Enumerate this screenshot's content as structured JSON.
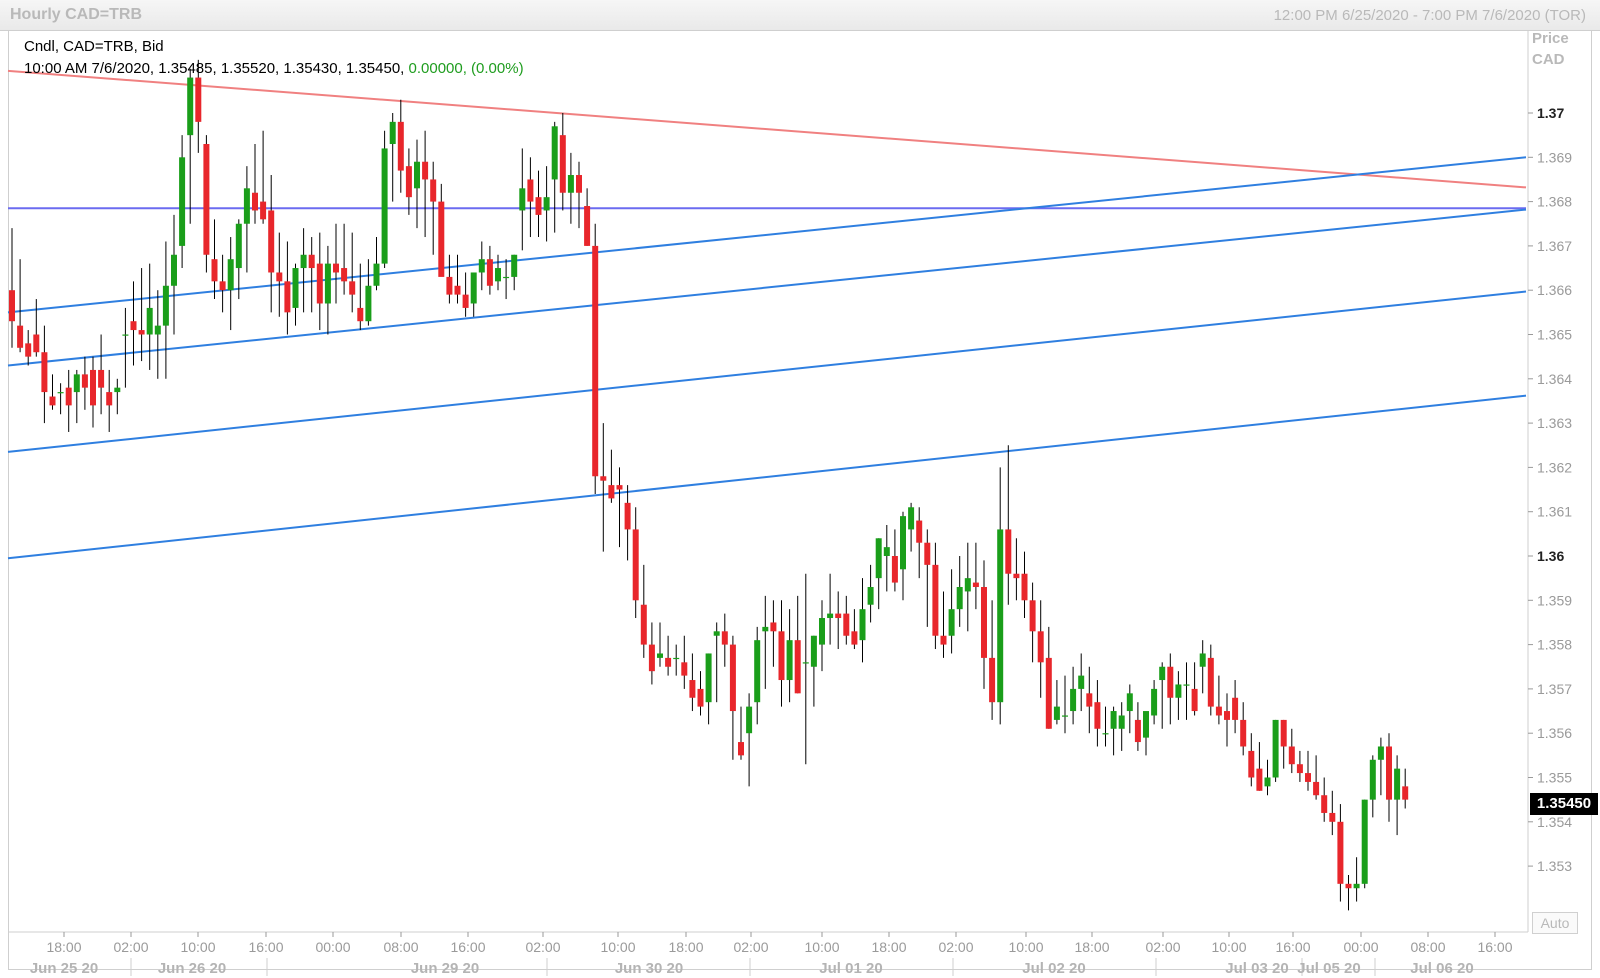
{
  "header": {
    "title": "Hourly CAD=TRB",
    "range": "12:00 PM 6/25/2020 - 7:00 PM 7/6/2020 (TOR)"
  },
  "legend": {
    "line1": "Cndl, CAD=TRB, Bid",
    "line2": "10:00 AM 7/6/2020, 1.35485, 1.35520, 1.35430, 1.35450,",
    "change": "0.00000, (0.00%)"
  },
  "axis": {
    "price_label_1": "Price",
    "price_label_2": "CAD",
    "auto": "Auto",
    "last_price": "1.35450"
  },
  "colors": {
    "up": "#1a9e1a",
    "down": "#e8262b",
    "wick": "#000000",
    "trend_red": "#f08080",
    "trend_blue": "#2f7fe0",
    "horizontal": "#6b6bf0"
  },
  "chart_data": {
    "type": "candlestick",
    "title": "Hourly CAD=TRB",
    "ylabel": "Price CAD",
    "ylim": [
      1.3521,
      1.3714
    ],
    "yticks": [
      "1.37",
      "1.369",
      "1.368",
      "1.367",
      "1.366",
      "1.365",
      "1.364",
      "1.363",
      "1.362",
      "1.361",
      "1.36",
      "1.359",
      "1.358",
      "1.357",
      "1.356",
      "1.355",
      "1.354",
      "1.353"
    ],
    "x_time_labels": [
      "18:00",
      "02:00",
      "10:00",
      "16:00",
      "00:00",
      "08:00",
      "16:00",
      "02:00",
      "10:00",
      "18:00",
      "02:00",
      "10:00",
      "18:00",
      "02:00",
      "10:00",
      "18:00",
      "02:00",
      "10:00",
      "16:00",
      "00:00",
      "08:00",
      "16:00"
    ],
    "x_date_labels": [
      "Jun 25 20",
      "Jun 26 20",
      "Jun 29 20",
      "Jun 30 20",
      "Jul 01 20",
      "Jul 02 20",
      "Jul 03 20",
      "Jul 05 20",
      "Jul 06 20"
    ],
    "candles": [
      [
        1.366,
        1.3674,
        1.3647,
        1.3653
      ],
      [
        1.3652,
        1.3667,
        1.3646,
        1.3647
      ],
      [
        1.3648,
        1.3651,
        1.3643,
        1.3645
      ],
      [
        1.365,
        1.3658,
        1.3645,
        1.3646
      ],
      [
        1.3646,
        1.3652,
        1.363,
        1.3637
      ],
      [
        1.3636,
        1.3641,
        1.3633,
        1.3634
      ],
      [
        1.3637,
        1.3639,
        1.3632,
        1.3637
      ],
      [
        1.3638,
        1.3642,
        1.3628,
        1.3634
      ],
      [
        1.3637,
        1.3642,
        1.363,
        1.3641
      ],
      [
        1.3641,
        1.3645,
        1.3633,
        1.3638
      ],
      [
        1.3642,
        1.3645,
        1.3629,
        1.3634
      ],
      [
        1.3642,
        1.365,
        1.3632,
        1.3638
      ],
      [
        1.3637,
        1.3642,
        1.3628,
        1.3634
      ],
      [
        1.3637,
        1.364,
        1.3632,
        1.3638
      ],
      [
        1.365,
        1.3656,
        1.3638,
        1.365
      ],
      [
        1.3653,
        1.3662,
        1.3643,
        1.3651
      ],
      [
        1.3651,
        1.3665,
        1.3644,
        1.365
      ],
      [
        1.365,
        1.3666,
        1.3642,
        1.3656
      ],
      [
        1.365,
        1.366,
        1.364,
        1.3652
      ],
      [
        1.3652,
        1.3671,
        1.364,
        1.3661
      ],
      [
        1.3661,
        1.3677,
        1.365,
        1.3668
      ],
      [
        1.367,
        1.3695,
        1.3665,
        1.369
      ],
      [
        1.3695,
        1.371,
        1.3675,
        1.3708
      ],
      [
        1.3708,
        1.3712,
        1.3691,
        1.3698
      ],
      [
        1.3693,
        1.3695,
        1.3664,
        1.3668
      ],
      [
        1.3667,
        1.3676,
        1.3658,
        1.3662
      ],
      [
        1.3662,
        1.3668,
        1.3655,
        1.366
      ],
      [
        1.366,
        1.3672,
        1.3651,
        1.3667
      ],
      [
        1.3665,
        1.3676,
        1.3658,
        1.3675
      ],
      [
        1.3675,
        1.3688,
        1.3664,
        1.3683
      ],
      [
        1.3682,
        1.3693,
        1.3675,
        1.3678
      ],
      [
        1.368,
        1.3696,
        1.3675,
        1.3676
      ],
      [
        1.3678,
        1.3686,
        1.3655,
        1.3664
      ],
      [
        1.3664,
        1.3673,
        1.3654,
        1.3662
      ],
      [
        1.3662,
        1.3671,
        1.365,
        1.3655
      ],
      [
        1.3656,
        1.3666,
        1.3652,
        1.3665
      ],
      [
        1.3665,
        1.3674,
        1.3655,
        1.3668
      ],
      [
        1.3668,
        1.3672,
        1.3655,
        1.3665
      ],
      [
        1.3666,
        1.3673,
        1.3651,
        1.3657
      ],
      [
        1.3657,
        1.367,
        1.365,
        1.3666
      ],
      [
        1.3666,
        1.3675,
        1.3657,
        1.3664
      ],
      [
        1.3665,
        1.3675,
        1.3659,
        1.3662
      ],
      [
        1.3662,
        1.3673,
        1.3655,
        1.3659
      ],
      [
        1.3656,
        1.3666,
        1.3651,
        1.3653
      ],
      [
        1.3653,
        1.3667,
        1.3652,
        1.3661
      ],
      [
        1.3661,
        1.3672,
        1.366,
        1.3666
      ],
      [
        1.3666,
        1.3696,
        1.3665,
        1.3692
      ],
      [
        1.3693,
        1.37,
        1.368,
        1.3698
      ],
      [
        1.3698,
        1.3703,
        1.3682,
        1.3687
      ],
      [
        1.3688,
        1.3692,
        1.3677,
        1.3681
      ],
      [
        1.3683,
        1.3694,
        1.3674,
        1.3689
      ],
      [
        1.3689,
        1.3696,
        1.3672,
        1.3685
      ],
      [
        1.3685,
        1.3689,
        1.3668,
        1.368
      ],
      [
        1.368,
        1.3684,
        1.3664,
        1.3663
      ],
      [
        1.3663,
        1.3668,
        1.3657,
        1.3659
      ],
      [
        1.3661,
        1.3668,
        1.3657,
        1.3659
      ],
      [
        1.3659,
        1.3664,
        1.3654,
        1.3656
      ],
      [
        1.3657,
        1.3664,
        1.3654,
        1.3664
      ],
      [
        1.3664,
        1.3671,
        1.366,
        1.3667
      ],
      [
        1.3667,
        1.367,
        1.3659,
        1.3661
      ],
      [
        1.3662,
        1.3668,
        1.366,
        1.3665
      ],
      [
        1.3663,
        1.3667,
        1.3658,
        1.3663
      ],
      [
        1.3663,
        1.3668,
        1.366,
        1.3668
      ],
      [
        1.3678,
        1.3692,
        1.3669,
        1.3683
      ],
      [
        1.3685,
        1.369,
        1.3672,
        1.368
      ],
      [
        1.3681,
        1.3687,
        1.3672,
        1.3677
      ],
      [
        1.3678,
        1.3688,
        1.3671,
        1.3681
      ],
      [
        1.3685,
        1.3698,
        1.3673,
        1.3697
      ],
      [
        1.3695,
        1.37,
        1.3678,
        1.3682
      ],
      [
        1.3682,
        1.3691,
        1.3675,
        1.3686
      ],
      [
        1.3686,
        1.3689,
        1.3674,
        1.3682
      ],
      [
        1.3679,
        1.3683,
        1.367,
        1.367
      ],
      [
        1.367,
        1.3675,
        1.3614,
        1.3618
      ],
      [
        1.3618,
        1.363,
        1.3601,
        1.3617
      ],
      [
        1.3616,
        1.3624,
        1.3612,
        1.3613
      ],
      [
        1.3616,
        1.362,
        1.3602,
        1.3615
      ],
      [
        1.3612,
        1.3616,
        1.3599,
        1.3606
      ],
      [
        1.3606,
        1.3611,
        1.3586,
        1.359
      ],
      [
        1.3589,
        1.3598,
        1.3577,
        1.358
      ],
      [
        1.358,
        1.3585,
        1.3571,
        1.3574
      ],
      [
        1.3577,
        1.3585,
        1.3575,
        1.3578
      ],
      [
        1.3577,
        1.3582,
        1.3573,
        1.3575
      ],
      [
        1.3577,
        1.358,
        1.3573,
        1.3577
      ],
      [
        1.3576,
        1.3582,
        1.357,
        1.3573
      ],
      [
        1.3572,
        1.3578,
        1.3565,
        1.3568
      ],
      [
        1.357,
        1.3574,
        1.3564,
        1.3566
      ],
      [
        1.3567,
        1.3578,
        1.3562,
        1.3578
      ],
      [
        1.3582,
        1.3585,
        1.3567,
        1.3583
      ],
      [
        1.3583,
        1.3587,
        1.3575,
        1.358
      ],
      [
        1.358,
        1.3582,
        1.3554,
        1.3565
      ],
      [
        1.3558,
        1.3566,
        1.3554,
        1.3555
      ],
      [
        1.356,
        1.3569,
        1.3548,
        1.3566
      ],
      [
        1.3567,
        1.3584,
        1.3562,
        1.3581
      ],
      [
        1.3583,
        1.3591,
        1.357,
        1.3584
      ],
      [
        1.3585,
        1.359,
        1.3575,
        1.3583
      ],
      [
        1.3583,
        1.359,
        1.3566,
        1.3572
      ],
      [
        1.3572,
        1.3588,
        1.3567,
        1.3581
      ],
      [
        1.3581,
        1.3591,
        1.3569,
        1.3569
      ],
      [
        1.3576,
        1.3596,
        1.3553,
        1.3576
      ],
      [
        1.3575,
        1.3582,
        1.3566,
        1.3582
      ],
      [
        1.358,
        1.359,
        1.3574,
        1.3586
      ],
      [
        1.3586,
        1.3596,
        1.358,
        1.3587
      ],
      [
        1.3587,
        1.3592,
        1.3579,
        1.3586
      ],
      [
        1.3587,
        1.3591,
        1.358,
        1.3582
      ],
      [
        1.3583,
        1.3588,
        1.3579,
        1.358
      ],
      [
        1.3581,
        1.3595,
        1.3576,
        1.3588
      ],
      [
        1.3589,
        1.3598,
        1.3585,
        1.3593
      ],
      [
        1.3595,
        1.3604,
        1.3588,
        1.3604
      ],
      [
        1.36,
        1.3607,
        1.3592,
        1.3602
      ],
      [
        1.36,
        1.3606,
        1.3592,
        1.3594
      ],
      [
        1.3597,
        1.361,
        1.359,
        1.3609
      ],
      [
        1.3606,
        1.3612,
        1.3601,
        1.3611
      ],
      [
        1.3608,
        1.3611,
        1.3595,
        1.3603
      ],
      [
        1.3603,
        1.3606,
        1.3584,
        1.3598
      ],
      [
        1.3598,
        1.3603,
        1.3579,
        1.3582
      ],
      [
        1.3582,
        1.3592,
        1.3577,
        1.358
      ],
      [
        1.3582,
        1.3597,
        1.3578,
        1.3588
      ],
      [
        1.3588,
        1.36,
        1.3584,
        1.3593
      ],
      [
        1.3592,
        1.3603,
        1.3583,
        1.3595
      ],
      [
        1.3594,
        1.3603,
        1.3588,
        1.3593
      ],
      [
        1.3593,
        1.3599,
        1.357,
        1.3577
      ],
      [
        1.3577,
        1.359,
        1.3563,
        1.3567
      ],
      [
        1.3567,
        1.362,
        1.3562,
        1.3606
      ],
      [
        1.3606,
        1.3625,
        1.3589,
        1.3596
      ],
      [
        1.3596,
        1.3604,
        1.359,
        1.3595
      ],
      [
        1.3596,
        1.3601,
        1.3586,
        1.359
      ],
      [
        1.359,
        1.3594,
        1.3576,
        1.3583
      ],
      [
        1.3583,
        1.359,
        1.3568,
        1.3576
      ],
      [
        1.3577,
        1.3584,
        1.3561,
        1.3561
      ],
      [
        1.3563,
        1.3572,
        1.3562,
        1.3566
      ],
      [
        1.3564,
        1.3573,
        1.356,
        1.3564
      ],
      [
        1.3565,
        1.3575,
        1.3562,
        1.357
      ],
      [
        1.357,
        1.3578,
        1.3565,
        1.3573
      ],
      [
        1.3569,
        1.3575,
        1.356,
        1.3566
      ],
      [
        1.3567,
        1.3572,
        1.3557,
        1.3561
      ],
      [
        1.356,
        1.3566,
        1.3557,
        1.356
      ],
      [
        1.3561,
        1.3566,
        1.3555,
        1.3565
      ],
      [
        1.3561,
        1.3567,
        1.3556,
        1.3564
      ],
      [
        1.3565,
        1.3571,
        1.356,
        1.3569
      ],
      [
        1.3563,
        1.3567,
        1.3556,
        1.3558
      ],
      [
        1.3559,
        1.3564,
        1.3555,
        1.3565
      ],
      [
        1.3564,
        1.3572,
        1.3562,
        1.357
      ],
      [
        1.3572,
        1.3576,
        1.3561,
        1.3575
      ],
      [
        1.3575,
        1.3578,
        1.3562,
        1.3568
      ],
      [
        1.3568,
        1.3574,
        1.3563,
        1.3571
      ],
      [
        1.3571,
        1.3576,
        1.3563,
        1.3571
      ],
      [
        1.357,
        1.3576,
        1.3564,
        1.3565
      ],
      [
        1.3575,
        1.3581,
        1.3569,
        1.3578
      ],
      [
        1.3577,
        1.358,
        1.3564,
        1.3566
      ],
      [
        1.3566,
        1.3573,
        1.3562,
        1.3564
      ],
      [
        1.3565,
        1.3569,
        1.3557,
        1.3563
      ],
      [
        1.3568,
        1.3572,
        1.356,
        1.3563
      ],
      [
        1.3563,
        1.3567,
        1.3555,
        1.3557
      ],
      [
        1.3556,
        1.356,
        1.3548,
        1.355
      ],
      [
        1.3552,
        1.3558,
        1.3547,
        1.3547
      ],
      [
        1.3548,
        1.3554,
        1.3546,
        1.355
      ],
      [
        1.355,
        1.3563,
        1.3549,
        1.3563
      ],
      [
        1.3563,
        1.3563,
        1.3552,
        1.3557
      ],
      [
        1.3557,
        1.3561,
        1.3551,
        1.3553
      ],
      [
        1.3553,
        1.3556,
        1.3549,
        1.3551
      ],
      [
        1.3551,
        1.3556,
        1.3547,
        1.3549
      ],
      [
        1.3549,
        1.3555,
        1.3545,
        1.3546
      ],
      [
        1.3546,
        1.355,
        1.354,
        1.3542
      ],
      [
        1.3542,
        1.3547,
        1.3537,
        1.354
      ],
      [
        1.354,
        1.3544,
        1.3522,
        1.3526
      ],
      [
        1.3526,
        1.3528,
        1.352,
        1.3525
      ],
      [
        1.3525,
        1.3532,
        1.3522,
        1.3526
      ],
      [
        1.3526,
        1.3545,
        1.3525,
        1.3545
      ],
      [
        1.3545,
        1.3555,
        1.3541,
        1.3554
      ],
      [
        1.3554,
        1.3559,
        1.3546,
        1.3557
      ],
      [
        1.3557,
        1.356,
        1.354,
        1.3545
      ],
      [
        1.3545,
        1.3555,
        1.3537,
        1.3552
      ],
      [
        1.3548,
        1.3552,
        1.3543,
        1.3545
      ]
    ],
    "trendlines": [
      {
        "name": "red-resistance",
        "color": "#f08080",
        "from": [
          0,
          1.37095
        ],
        "to": [
          183,
          1.36832
        ]
      },
      {
        "name": "horizontal",
        "color": "#6b6bf0",
        "from": [
          0,
          1.36785
        ],
        "to": [
          183,
          1.36785
        ]
      },
      {
        "name": "blue-1",
        "color": "#2f7fe0",
        "from": [
          0,
          1.3655
        ],
        "to": [
          183,
          1.369
        ]
      },
      {
        "name": "blue-2",
        "color": "#2f7fe0",
        "from": [
          0,
          1.3643
        ],
        "to": [
          183,
          1.36782
        ]
      },
      {
        "name": "blue-3",
        "color": "#2f7fe0",
        "from": [
          0,
          1.36235
        ],
        "to": [
          183,
          1.36597
        ]
      },
      {
        "name": "blue-4",
        "color": "#2f7fe0",
        "from": [
          0,
          1.35995
        ],
        "to": [
          183,
          1.36362
        ]
      }
    ]
  }
}
